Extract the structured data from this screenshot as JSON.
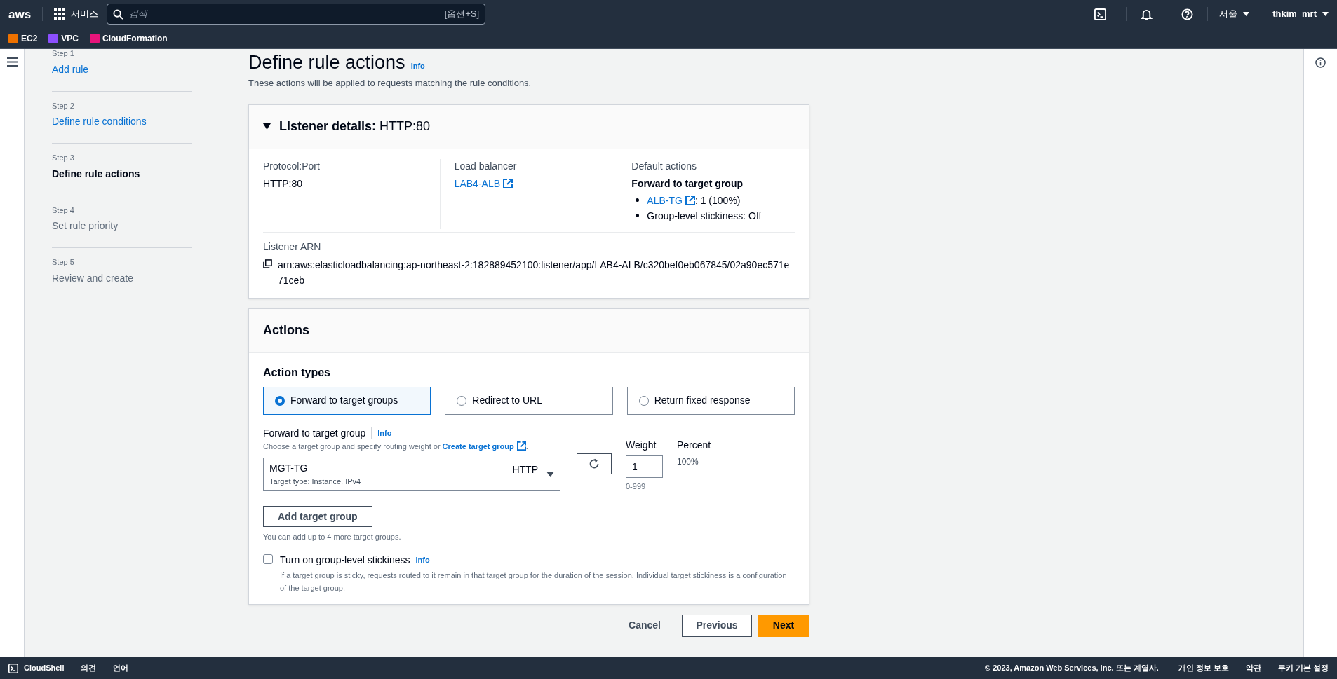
{
  "top_nav": {
    "logo": "aws",
    "services": "서비스",
    "search": {
      "placeholder": "검색",
      "shortcut": "[옵션+S]"
    },
    "region": "서울",
    "user": "thkim_mrt"
  },
  "favorites": [
    {
      "label": "EC2",
      "color": "#ed7100"
    },
    {
      "label": "VPC",
      "color": "#8c4fff"
    },
    {
      "label": "CloudFormation",
      "color": "#e7157b"
    }
  ],
  "steps": [
    {
      "step": "Step 1",
      "title": "Add rule",
      "selected": false,
      "disabled": false
    },
    {
      "step": "Step 2",
      "title": "Define rule conditions",
      "selected": false,
      "disabled": false
    },
    {
      "step": "Step 3",
      "title": "Define rule actions",
      "selected": true,
      "disabled": false
    },
    {
      "step": "Step 4",
      "title": "Set rule priority",
      "selected": false,
      "disabled": true
    },
    {
      "step": "Step 5",
      "title": "Review and create",
      "selected": false,
      "disabled": true
    }
  ],
  "page": {
    "title": "Define rule actions",
    "info": "Info",
    "description": "These actions will be applied to requests matching the rule conditions."
  },
  "listener": {
    "expanded": true,
    "title": "Listener details:",
    "title_value": "HTTP:80",
    "protocol": {
      "label": "Protocol:Port",
      "value": "HTTP:80"
    },
    "load_balancer": {
      "label": "Load balancer",
      "link": "LAB4-ALB"
    },
    "default_actions": {
      "label": "Default actions",
      "heading": "Forward to target group",
      "items": [
        {
          "link": "ALB-TG",
          "text": ": 1 (100%)"
        },
        {
          "text": "Group-level stickiness: Off"
        }
      ]
    },
    "arn": {
      "label": "Listener ARN",
      "value": "arn:aws:elasticloadbalancing:ap-northeast-2:182889452100:listener/app/LAB4-ALB/c320bef0eb067845/02a90ec571e71ceb"
    }
  },
  "actions": {
    "title": "Actions",
    "types_label": "Action types",
    "options": [
      {
        "label": "Forward to target groups",
        "selected": true
      },
      {
        "label": "Redirect to URL",
        "selected": false
      },
      {
        "label": "Return fixed response",
        "selected": false
      }
    ],
    "forward": {
      "label": "Forward to target group",
      "info": "Info",
      "hint": "Choose a target group and specify routing weight or",
      "hint_link": "Create target group",
      "hint_end": "."
    },
    "target": {
      "name": "MGT-TG",
      "protocol": "HTTP",
      "detail": "Target type: Instance, IPv4"
    },
    "weight": {
      "label": "Weight",
      "value": "1",
      "hint": "0-999"
    },
    "percent": {
      "label": "Percent",
      "value": "100%"
    },
    "add_button": "Add target group",
    "add_hint": "You can add up to 4 more target groups.",
    "stickiness": {
      "label": "Turn on group-level stickiness",
      "info": "Info",
      "checked": false,
      "description": "If a target group is sticky, requests routed to it remain in that target group for the duration of the session. Individual target stickiness is a configuration of the target group."
    }
  },
  "buttons": {
    "cancel": "Cancel",
    "previous": "Previous",
    "next": "Next"
  },
  "footer": {
    "cloudshell": "CloudShell",
    "links": [
      "의견",
      "언어"
    ],
    "copyright": "© 2023, Amazon Web Services, Inc. 또는 계열사.",
    "right_links": [
      "개인 정보 보호",
      "약관",
      "쿠키 기본 설정"
    ]
  }
}
